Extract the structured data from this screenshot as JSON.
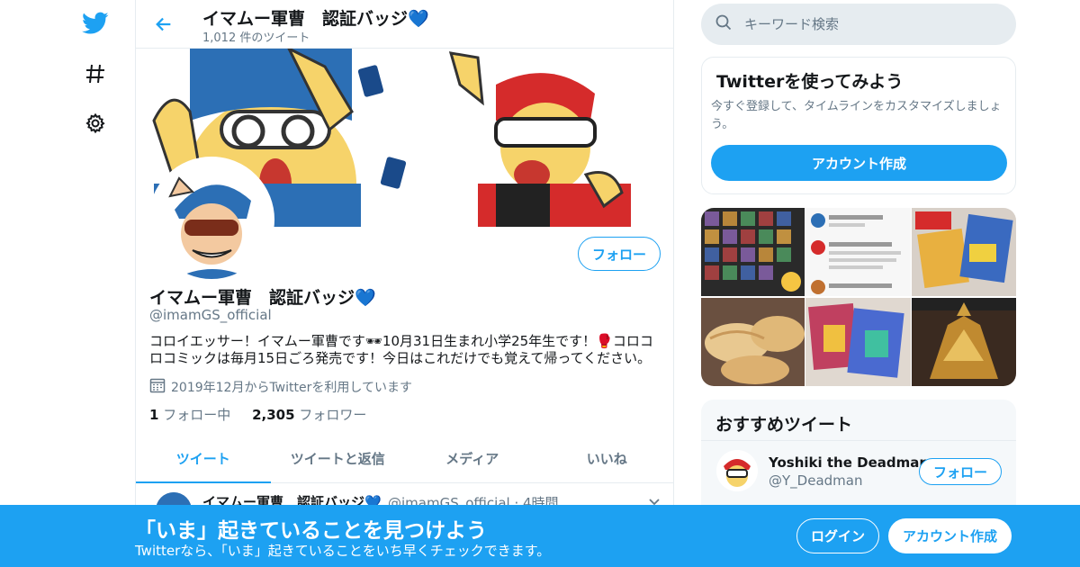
{
  "colors": {
    "accent": "#1da1f2",
    "text": "#14171a",
    "muted": "#657786",
    "border": "#e6ecf0"
  },
  "nav": {
    "icons": [
      "twitter-logo-icon",
      "hashtag-icon",
      "gear-icon"
    ]
  },
  "header": {
    "title": "イマムー軍曹　認証バッジ💙",
    "tweet_count": "1,012 件のツイート"
  },
  "profile": {
    "name": "イマムー軍曹　認証バッジ💙",
    "handle": "@imamGS_official",
    "follow_label": "フォロー",
    "bio": "コロイエッサー！イマムー軍曹です🕶10月31日生まれ小学25年生です！🥊コロコロコミックは毎月15日ごろ発売です！今日はこれだけでも覚えて帰ってください。",
    "joined": "2019年12月からTwitterを利用しています",
    "following_count": "1",
    "following_label": "フォロー中",
    "followers_count": "2,305",
    "followers_label": "フォロワー"
  },
  "tabs": [
    {
      "label": "ツイート",
      "active": true
    },
    {
      "label": "ツイートと返信",
      "active": false
    },
    {
      "label": "メディア",
      "active": false
    },
    {
      "label": "いいね",
      "active": false
    }
  ],
  "tweet": {
    "name": "イマムー軍曹　認証バッジ💙",
    "meta": "@imamGS_official · 4時間"
  },
  "search": {
    "placeholder": "キーワード検索"
  },
  "signup_box": {
    "title": "Twitterを使ってみよう",
    "desc": "今すぐ登録して、タイムラインをカスタマイズしましょう。",
    "button": "アカウント作成"
  },
  "recommended": {
    "title": "おすすめツイート",
    "user_name": "Yoshiki the Deadman",
    "user_handle": "@Y_Deadman",
    "follow_label": "フォロー"
  },
  "bottom_bar": {
    "title": "「いま」起きていることを見つけよう",
    "subtitle": "Twitterなら、「いま」起きていることをいち早くチェックできます。",
    "login": "ログイン",
    "signup": "アカウント作成"
  }
}
